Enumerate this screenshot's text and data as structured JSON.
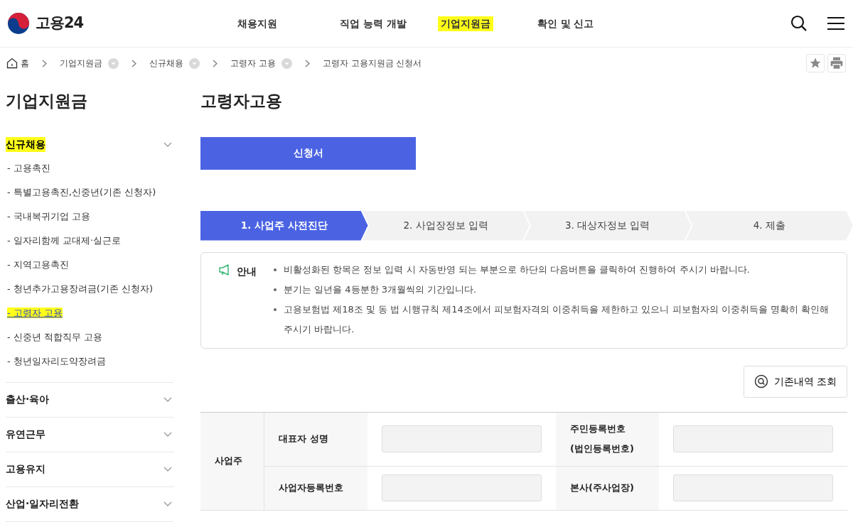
{
  "header": {
    "logo_text": "고용24",
    "nav": [
      {
        "label": "채용지원",
        "selected": false
      },
      {
        "label": "직업 능력 개발",
        "selected": false
      },
      {
        "label": "기업지원금",
        "selected": true
      },
      {
        "label": "확인 및 신고",
        "selected": false
      }
    ]
  },
  "breadcrumb": [
    {
      "label": "홈",
      "kind": "home"
    },
    {
      "label": "기업지원금",
      "kind": "menu"
    },
    {
      "label": "신규채용",
      "kind": "menu"
    },
    {
      "label": "고령자 고용",
      "kind": "menu"
    },
    {
      "label": "고령자 고용지원금 신청서",
      "kind": "current"
    }
  ],
  "sidebar": {
    "title": "기업지원금",
    "sections": [
      {
        "label": "신규채용",
        "selected": true,
        "expanded": true,
        "children": [
          {
            "label": "- 고용촉진",
            "selected": false
          },
          {
            "label": "- 특별고용촉진,신중년(기존 신청자)",
            "selected": false
          },
          {
            "label": "- 국내복귀기업 고용",
            "selected": false
          },
          {
            "label": "- 일자리함께 교대제·실근로",
            "selected": false
          },
          {
            "label": "- 지역고용촉진",
            "selected": false
          },
          {
            "label": "- 청년추가고용장려금(기존 신청자)",
            "selected": false
          },
          {
            "label": "- 고령자 고용",
            "selected": true
          },
          {
            "label": "- 신중년 적합직무 고용",
            "selected": false
          },
          {
            "label": "- 청년일자리도약장려금",
            "selected": false
          }
        ]
      },
      {
        "label": "출산·육아",
        "selected": false,
        "expanded": false
      },
      {
        "label": "유연근무",
        "selected": false,
        "expanded": false
      },
      {
        "label": "고용유지",
        "selected": false,
        "expanded": false
      },
      {
        "label": "산업·일자리전환",
        "selected": false,
        "expanded": false
      }
    ]
  },
  "page_title": "고령자고용",
  "tabs": [
    {
      "label": "신청서",
      "selected": true
    }
  ],
  "steps": [
    {
      "label": "1. 사업주 사전진단",
      "selected": true
    },
    {
      "label": "2. 사업장정보 입력",
      "selected": false
    },
    {
      "label": "3. 대상자정보 입력",
      "selected": false
    },
    {
      "label": "4. 제출",
      "selected": false
    }
  ],
  "notice": {
    "label": "안내",
    "items": [
      "비활성화된 항목은 정보 입력 시 자동반영 되는 부분으로 하단의 다음버튼을 클릭하여 진행하여 주시기 바랍니다.",
      "분기는 일년을 4등분한 3개월씩의 기간입니다.",
      "고용보험법 제18조 및 동 법 시행규칙 제14조에서 피보험자격의 이중취득을 제한하고 있으니 피보험자의 이중취득을 명확히 확인해 주시기 바랍니다."
    ]
  },
  "history_button": "기존내역 조회",
  "form": {
    "group": "사업주",
    "rows": [
      {
        "fields": [
          {
            "label": "대표자 성명",
            "disabled": true
          },
          {
            "label": "주민등록번호\n(법인등록번호)",
            "disabled": true
          }
        ]
      },
      {
        "fields": [
          {
            "label": "사업자등록번호",
            "disabled": true
          },
          {
            "label": "본사(주사업장)",
            "disabled": true
          }
        ]
      }
    ]
  }
}
